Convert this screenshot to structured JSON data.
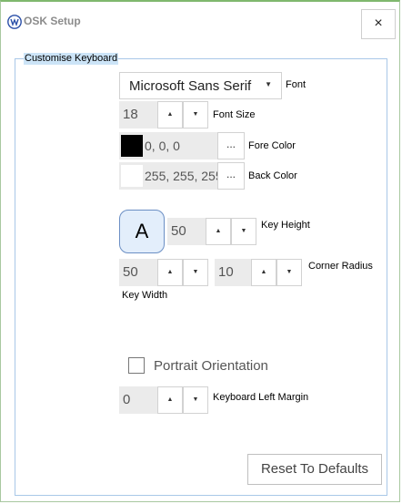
{
  "window": {
    "title": "OSK Setup",
    "close_label": "×"
  },
  "group": {
    "legend": "Customise Keyboard"
  },
  "font": {
    "selected": "Microsoft Sans Serif",
    "label": "Font"
  },
  "font_size": {
    "value": "18",
    "label": "Font Size"
  },
  "fore_color": {
    "value": "0, 0, 0",
    "label": "Fore Color",
    "swatch": "#000000",
    "button_label": "..."
  },
  "back_color": {
    "value": "255, 255, 255",
    "label": "Back Color",
    "swatch": "#ffffff",
    "button_label": "..."
  },
  "key_preview": {
    "letter": "A"
  },
  "key_height": {
    "value": "50",
    "label": "Key Height"
  },
  "key_width": {
    "value": "50",
    "label": "Key Width"
  },
  "corner_radius": {
    "value": "10",
    "label": "Corner Radius"
  },
  "portrait": {
    "label": "Portrait Orientation",
    "checked": false
  },
  "left_margin": {
    "value": "0",
    "label": "Keyboard Left Margin"
  },
  "reset": {
    "label": "Reset To Defaults"
  },
  "spinner": {
    "up": "▲",
    "down": "▼"
  },
  "combo_arrow": "▼",
  "colors": {
    "title_bar_accent": "#7fb86e",
    "group_border": "#a9c8e8",
    "legend_background": "#cce4f7",
    "key_preview_border": "#6b8fc4",
    "key_preview_fill": "#e3eefb",
    "app_icon": "#2a4fa8"
  }
}
